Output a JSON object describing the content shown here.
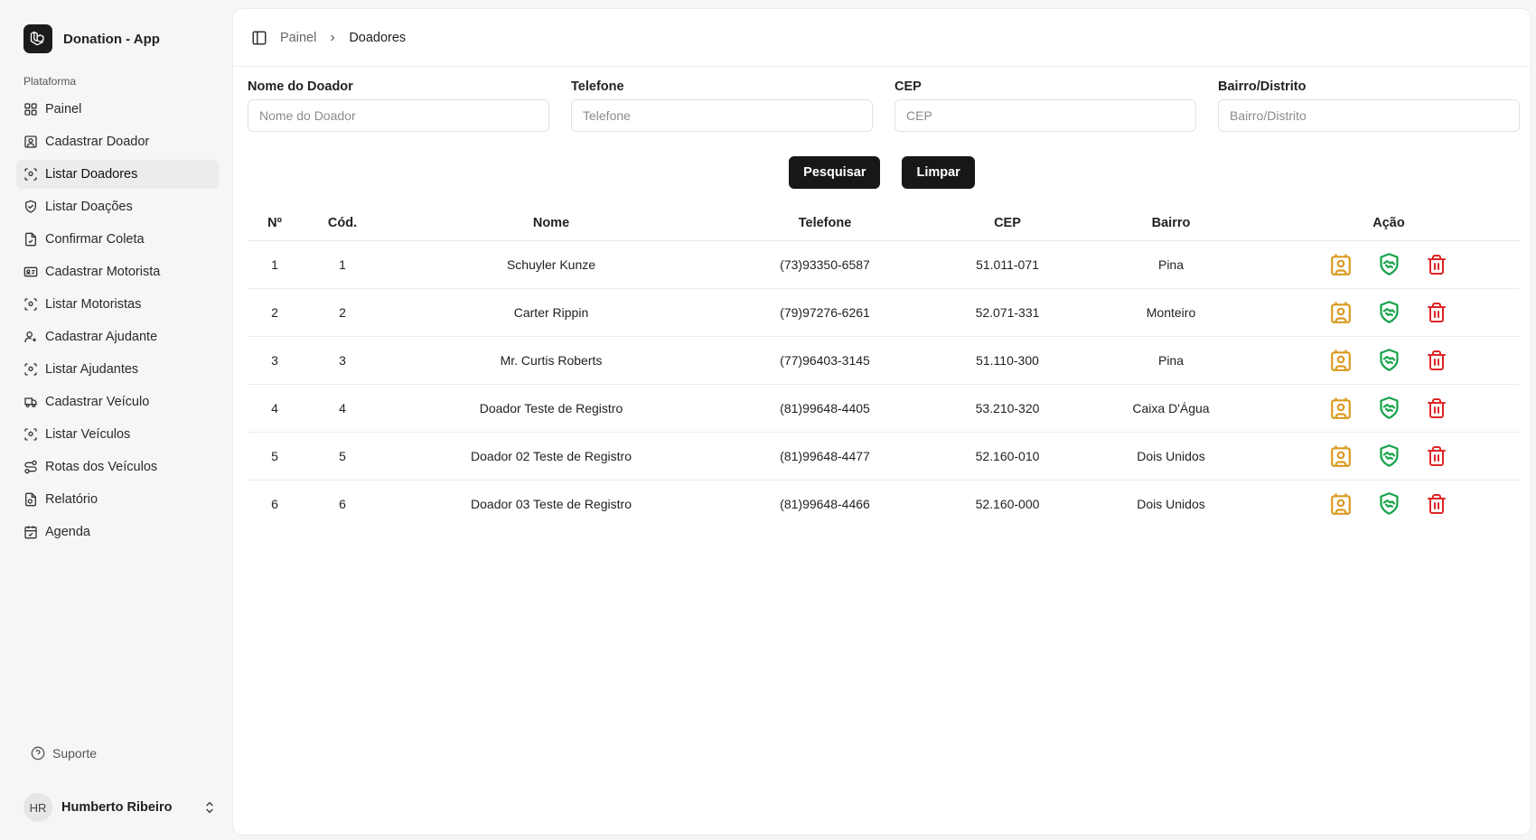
{
  "app": {
    "name": "Donation - App",
    "logo_icon": "laravel-logo-icon"
  },
  "sidebar": {
    "section_label": "Plataforma",
    "items": [
      {
        "label": "Painel",
        "icon": "layout-grid-icon",
        "active": false
      },
      {
        "label": "Cadastrar Doador",
        "icon": "contact-square-icon",
        "active": false
      },
      {
        "label": "Listar Doadores",
        "icon": "scan-user-icon",
        "active": true
      },
      {
        "label": "Listar Doações",
        "icon": "handshake-shield-icon",
        "active": false
      },
      {
        "label": "Confirmar Coleta",
        "icon": "file-check-icon",
        "active": false
      },
      {
        "label": "Cadastrar Motorista",
        "icon": "id-card-icon",
        "active": false
      },
      {
        "label": "Listar Motoristas",
        "icon": "scan-user-icon",
        "active": false
      },
      {
        "label": "Cadastrar Ajudante",
        "icon": "user-plus-icon",
        "active": false
      },
      {
        "label": "Listar Ajudantes",
        "icon": "scan-user-icon",
        "active": false
      },
      {
        "label": "Cadastrar Veículo",
        "icon": "truck-icon",
        "active": false
      },
      {
        "label": "Listar Veículos",
        "icon": "scan-user-icon",
        "active": false
      },
      {
        "label": "Rotas dos Veículos",
        "icon": "route-icon",
        "active": false
      },
      {
        "label": "Relatório",
        "icon": "file-chart-icon",
        "active": false
      },
      {
        "label": "Agenda",
        "icon": "calendar-check-icon",
        "active": false
      }
    ],
    "support_label": "Suporte",
    "user": {
      "initials": "HR",
      "name": "Humberto Ribeiro"
    }
  },
  "breadcrumb": {
    "parent": "Painel",
    "current": "Doadores"
  },
  "filters": [
    {
      "label": "Nome do Doador",
      "placeholder": "Nome do Doador",
      "value": ""
    },
    {
      "label": "Telefone",
      "placeholder": "Telefone",
      "value": ""
    },
    {
      "label": "CEP",
      "placeholder": "CEP",
      "value": ""
    },
    {
      "label": "Bairro/Distrito",
      "placeholder": "Bairro/Distrito",
      "value": ""
    }
  ],
  "buttons": {
    "search": "Pesquisar",
    "clear": "Limpar"
  },
  "table": {
    "columns": [
      "Nº",
      "Cód.",
      "Nome",
      "Telefone",
      "CEP",
      "Bairro",
      "Ação"
    ],
    "rows": [
      [
        "1",
        "1",
        "Schuyler Kunze",
        "(73)93350-6587",
        "51.011-071",
        "Pina"
      ],
      [
        "2",
        "2",
        "Carter Rippin",
        "(79)97276-6261",
        "52.071-331",
        "Monteiro"
      ],
      [
        "3",
        "3",
        "Mr. Curtis Roberts",
        "(77)96403-3145",
        "51.110-300",
        "Pina"
      ],
      [
        "4",
        "4",
        "Doador Teste de Registro",
        "(81)99648-4405",
        "53.210-320",
        "Caixa D'Água"
      ],
      [
        "5",
        "5",
        "Doador 02 Teste de Registro",
        "(81)99648-4477",
        "52.160-010",
        "Dois Unidos"
      ],
      [
        "6",
        "6",
        "Doador 03 Teste de Registro",
        "(81)99648-4466",
        "52.160-000",
        "Dois Unidos"
      ]
    ],
    "action_icons": [
      "contact-square-icon",
      "handshake-shield-icon",
      "trash-icon"
    ],
    "action_colors": {
      "view": "#d99a1e",
      "donate": "#16a34a",
      "delete": "#dc2626"
    }
  }
}
